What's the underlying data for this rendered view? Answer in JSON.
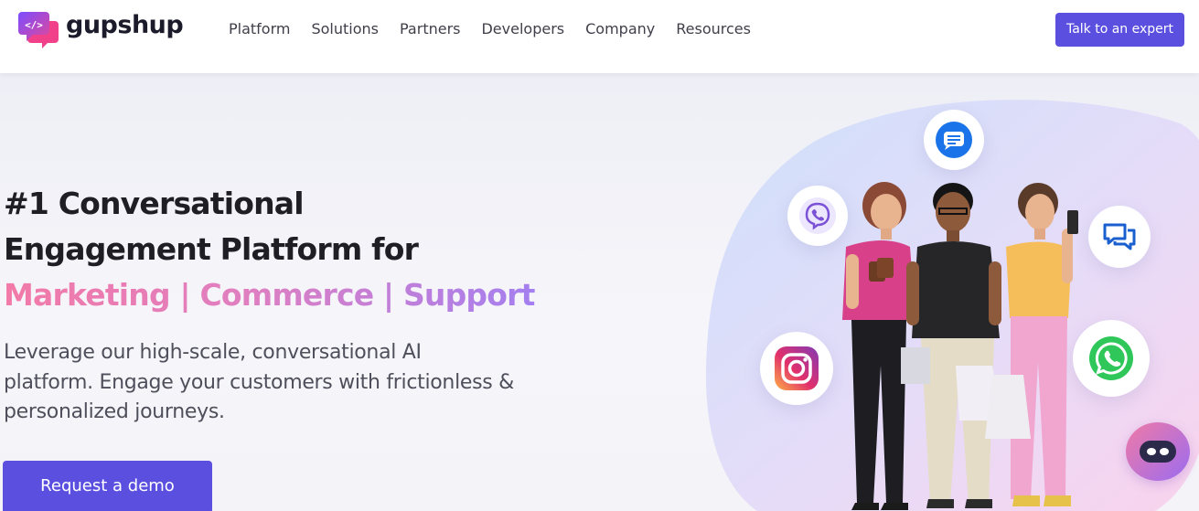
{
  "brand": {
    "name": "gupshup",
    "logo_symbol": "</>"
  },
  "nav": {
    "items": [
      "Platform",
      "Solutions",
      "Partners",
      "Developers",
      "Company",
      "Resources"
    ],
    "cta_label": "Talk to an expert"
  },
  "hero": {
    "headline_line1": "#1 Conversational",
    "headline_line2": "Engagement Platform for",
    "headline_highlight": "Marketing | Commerce | Support",
    "subtext": "Leverage our high-scale, conversational AI platform. Engage your customers with frictionless & personalized journeys.",
    "cta_label": "Request a demo"
  },
  "channel_icons": [
    "google-messages-icon",
    "viber-icon",
    "chat-bubbles-icon",
    "instagram-icon",
    "whatsapp-icon"
  ],
  "colors": {
    "accent": "#5b4fe0",
    "gradient_start": "#f27aa8",
    "gradient_end": "#a47ff0",
    "text_dark": "#1e1e24"
  }
}
